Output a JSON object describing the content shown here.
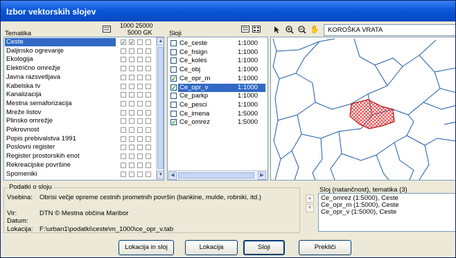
{
  "window": {
    "title": "Izbor vektorskih slojev"
  },
  "tematika": {
    "label": "Tematika",
    "scale_header_line1": "1000 25000",
    "scale_header_line2": "5000  GK",
    "items": [
      {
        "label": "Ceste",
        "selected": true,
        "checks": [
          true,
          true,
          false,
          false
        ]
      },
      {
        "label": "Daljinsko ogrevanje",
        "selected": false,
        "checks": [
          false,
          false,
          false,
          false
        ]
      },
      {
        "label": "Ekologija",
        "selected": false,
        "checks": [
          false,
          false,
          false,
          false
        ]
      },
      {
        "label": "Električno omrežje",
        "selected": false,
        "checks": [
          false,
          false,
          false,
          false
        ]
      },
      {
        "label": "Javna razsvetljava",
        "selected": false,
        "checks": [
          false,
          false,
          false,
          false
        ]
      },
      {
        "label": "Kabelska tv",
        "selected": false,
        "checks": [
          false,
          false,
          false,
          false
        ]
      },
      {
        "label": "Kanalizacija",
        "selected": false,
        "checks": [
          false,
          false,
          false,
          false
        ]
      },
      {
        "label": "Mestna semaforizacija",
        "selected": false,
        "checks": [
          false,
          false,
          false,
          false
        ]
      },
      {
        "label": "Mreže listov",
        "selected": false,
        "checks": [
          false,
          false,
          false,
          false
        ]
      },
      {
        "label": "Plinsko omrežje",
        "selected": false,
        "checks": [
          false,
          false,
          false,
          false
        ]
      },
      {
        "label": "Pokrovnost",
        "selected": false,
        "checks": [
          false,
          false,
          false,
          false
        ]
      },
      {
        "label": "Popis prebivalstva 1991",
        "selected": false,
        "checks": [
          false,
          false,
          false,
          false
        ]
      },
      {
        "label": "Poslovni register",
        "selected": false,
        "checks": [
          false,
          false,
          false,
          false
        ]
      },
      {
        "label": "Register prostorskih enot",
        "selected": false,
        "checks": [
          false,
          false,
          false,
          false
        ]
      },
      {
        "label": "Rekreacijske površine",
        "selected": false,
        "checks": [
          false,
          false,
          false,
          false
        ]
      },
      {
        "label": "Spomeniki",
        "selected": false,
        "checks": [
          false,
          false,
          false,
          false
        ]
      }
    ]
  },
  "sloji": {
    "label": "Sloji",
    "items": [
      {
        "name": "Ce_ceste",
        "scale": "1:1000",
        "checked": false,
        "selected": false
      },
      {
        "name": "Ce_hsign",
        "scale": "1:1000",
        "checked": false,
        "selected": false
      },
      {
        "name": "Ce_koles",
        "scale": "1:1000",
        "checked": false,
        "selected": false
      },
      {
        "name": "Ce_obj",
        "scale": "1:1000",
        "checked": false,
        "selected": false
      },
      {
        "name": "Ce_opr_m",
        "scale": "1:1000",
        "checked": true,
        "selected": false
      },
      {
        "name": "Ce_opr_v",
        "scale": "1:1000",
        "checked": true,
        "selected": true
      },
      {
        "name": "Ce_parkp",
        "scale": "1:1000",
        "checked": false,
        "selected": false
      },
      {
        "name": "Ce_pesci",
        "scale": "1:1000",
        "checked": false,
        "selected": false
      },
      {
        "name": "Ce_imena",
        "scale": "1:5000",
        "checked": false,
        "selected": false
      },
      {
        "name": "Ce_omrez",
        "scale": "1:5000",
        "checked": true,
        "selected": false
      }
    ]
  },
  "map": {
    "location_value": "KOROŠKA VRATA"
  },
  "info": {
    "group_label": "Podatki o sloju",
    "vsebina_label": "Vsebina:",
    "vsebina_value": "Obrisi večje opreme cestnih prometnih površin (bankine, mulde, robniki, itd.)",
    "vir_label": "Vir:",
    "vir_value": "DTN © Mestna občina Maribor",
    "datum_label": "Datum:",
    "datum_value": "",
    "lokacija_label": "Lokacija:",
    "lokacija_value": "F:\\urban1\\podatki\\ceste\\m_1000\\ce_opr_v.tab"
  },
  "selected_layers": {
    "label": "Sloj (natančnost), tematika (3)",
    "items": [
      "Ce_omrez (1:5000), Ceste",
      "Ce_opr_m (1:5000), Ceste",
      "Ce_opr_v (1:5000), Ceste"
    ]
  },
  "buttons": {
    "lokacija_in_sloj": "Lokacija in sloj",
    "lokacija": "Lokacija",
    "sloji": "Sloji",
    "preklici": "Prekliči"
  }
}
